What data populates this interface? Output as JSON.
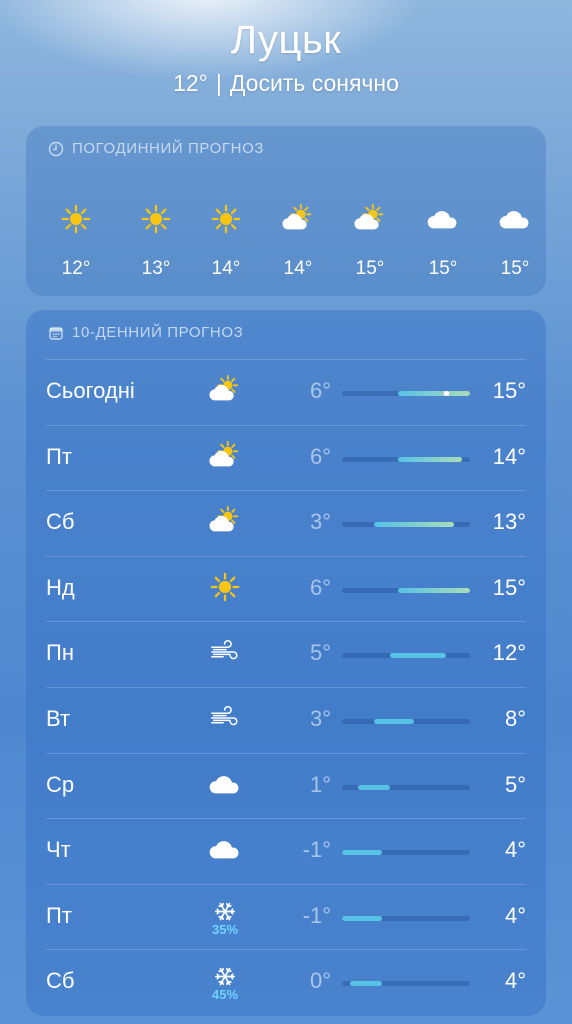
{
  "location": {
    "city": "Луцьк",
    "current_temp": "12°",
    "condition": "Досить сонячно"
  },
  "colors": {
    "sun": "#f6c514",
    "cloud": "#ffffff",
    "precip": "#6fd3ff",
    "bar_cool": "#56c2e6",
    "bar_warm": "#a9dcb6"
  },
  "hourly": {
    "title": "ПОГОДИННИЙ ПРОГНОЗ",
    "title_icon": "clock-icon",
    "items": [
      {
        "icon": "sun-icon",
        "temp": "12°"
      },
      {
        "icon": "sun-icon",
        "temp": "13°"
      },
      {
        "icon": "sun-icon",
        "temp": "14°"
      },
      {
        "icon": "partly-cloudy-icon",
        "temp": "14°"
      },
      {
        "icon": "partly-cloudy-icon",
        "temp": "15°"
      },
      {
        "icon": "cloud-icon",
        "temp": "15°"
      },
      {
        "icon": "cloud-icon",
        "temp": "15°"
      }
    ]
  },
  "daily": {
    "title": "10-ДЕННИЙ ПРОГНОЗ",
    "title_icon": "calendar-icon",
    "range_min": -1,
    "range_max": 15,
    "days": [
      {
        "day": "Сьогодні",
        "icon": "partly-cloudy-icon",
        "low": "6°",
        "high": "15°",
        "low_value": 6,
        "high_value": 15,
        "current_value": 12,
        "precip": ""
      },
      {
        "day": "Пт",
        "icon": "partly-cloudy-icon",
        "low": "6°",
        "high": "14°",
        "low_value": 6,
        "high_value": 14,
        "precip": ""
      },
      {
        "day": "Сб",
        "icon": "partly-cloudy-icon",
        "low": "3°",
        "high": "13°",
        "low_value": 3,
        "high_value": 13,
        "precip": ""
      },
      {
        "day": "Нд",
        "icon": "sun-icon",
        "low": "6°",
        "high": "15°",
        "low_value": 6,
        "high_value": 15,
        "precip": ""
      },
      {
        "day": "Пн",
        "icon": "wind-icon",
        "low": "5°",
        "high": "12°",
        "low_value": 5,
        "high_value": 12,
        "precip": ""
      },
      {
        "day": "Вт",
        "icon": "wind-icon",
        "low": "3°",
        "high": "8°",
        "low_value": 3,
        "high_value": 8,
        "precip": ""
      },
      {
        "day": "Ср",
        "icon": "cloud-icon",
        "low": "1°",
        "high": "5°",
        "low_value": 1,
        "high_value": 5,
        "precip": ""
      },
      {
        "day": "Чт",
        "icon": "cloud-icon",
        "low": "-1°",
        "high": "4°",
        "low_value": -1,
        "high_value": 4,
        "precip": ""
      },
      {
        "day": "Пт",
        "icon": "snow-icon",
        "low": "-1°",
        "high": "4°",
        "low_value": -1,
        "high_value": 4,
        "precip": "35%"
      },
      {
        "day": "Сб",
        "icon": "snow-icon",
        "low": "0°",
        "high": "4°",
        "low_value": 0,
        "high_value": 4,
        "precip": "45%"
      }
    ]
  }
}
